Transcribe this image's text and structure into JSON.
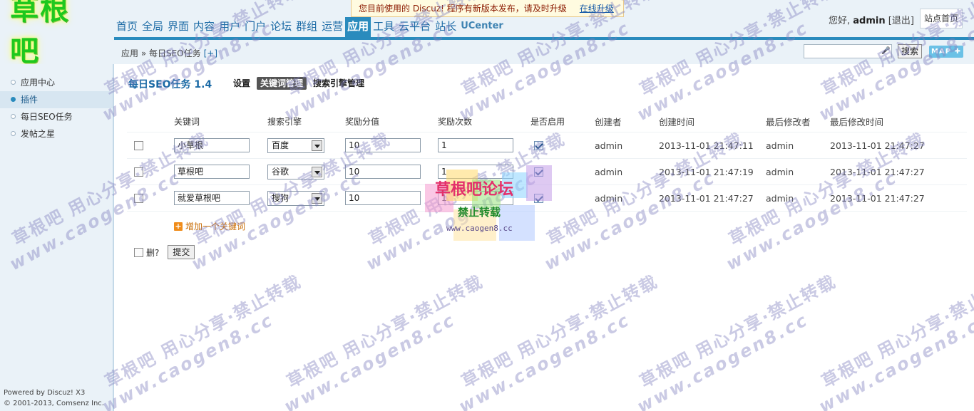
{
  "logo": {
    "text": "草根吧"
  },
  "notice": {
    "message": "您目前使用的 Discuz! 程序有新版本发布，请及时升级",
    "link": "在线升级"
  },
  "nav": {
    "items": [
      "首页",
      "全局",
      "界面",
      "内容",
      "用户",
      "门户",
      "论坛",
      "群组",
      "运营",
      "应用",
      "工具",
      "云平台",
      "站长",
      "UCenter"
    ],
    "active": "应用"
  },
  "user": {
    "greeting": "您好,",
    "name": "admin",
    "logout": "[退出]",
    "site_home": "站点首页"
  },
  "breadcrumb": {
    "text": "应用 » 每日SEO任务",
    "plus": "[+]"
  },
  "search": {
    "value": "",
    "button": "搜索",
    "map": "MAP"
  },
  "sidebar": {
    "items": [
      {
        "label": "应用中心"
      },
      {
        "label": "插件"
      },
      {
        "label": "每日SEO任务"
      },
      {
        "label": "发帖之星"
      }
    ],
    "current": 1
  },
  "footer": {
    "line1": "Powered by Discuz! X3",
    "line2": "© 2001-2013, Comsenz Inc."
  },
  "page": {
    "title": "每日SEO任务 1.4",
    "tabs": [
      "设置",
      "关键词管理",
      "搜索引擎管理"
    ],
    "active_tab": 1
  },
  "table": {
    "columns": [
      "关键词",
      "搜索引擎",
      "奖励分值",
      "奖励次数",
      "是否启用",
      "创建者",
      "创建时间",
      "最后修改者",
      "最后修改时间"
    ],
    "rows": [
      {
        "keyword": "小草根",
        "engine": "百度",
        "points": "10",
        "count": "1",
        "enabled": true,
        "creator": "admin",
        "created": "2013-11-01 21:47:11",
        "modifier": "admin",
        "modified": "2013-11-01 21:47:27"
      },
      {
        "keyword": "草根吧",
        "engine": "谷歌",
        "points": "10",
        "count": "1",
        "enabled": true,
        "creator": "admin",
        "created": "2013-11-01 21:47:19",
        "modifier": "admin",
        "modified": "2013-11-01 21:47:27"
      },
      {
        "keyword": "就爱草根吧",
        "engine": "搜狗",
        "points": "10",
        "count": "1",
        "enabled": true,
        "creator": "admin",
        "created": "2013-11-01 21:47:27",
        "modifier": "admin",
        "modified": "2013-11-01 21:47:27"
      }
    ]
  },
  "actions": {
    "add_keyword": "增加一个关键词",
    "delete_label": "删?",
    "submit": "提交"
  },
  "watermark": {
    "line1": "草根吧 用心分享·禁止转载",
    "line2": "www.caogen8.cc",
    "center_title": "草根吧论坛",
    "center_sub": "禁止转载",
    "center_url": "www.caogen8.cc"
  }
}
